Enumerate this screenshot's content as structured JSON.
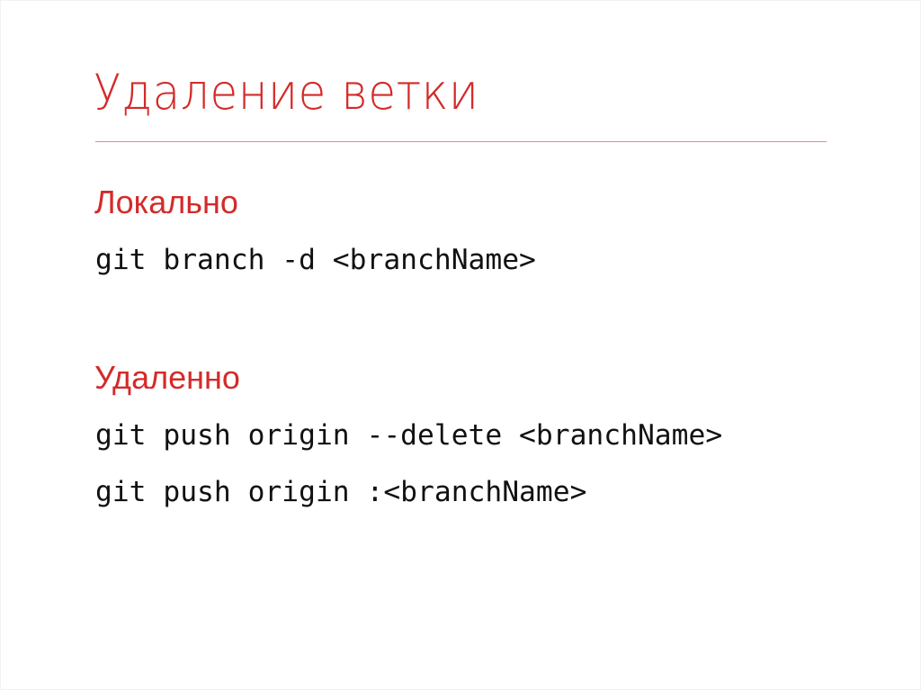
{
  "slide": {
    "title": "Удаление ветки",
    "accent_color": "#d42a2a",
    "sections": [
      {
        "heading": "Локально",
        "commands": [
          "git branch -d <branchName>"
        ]
      },
      {
        "heading": "Удаленно",
        "commands": [
          "git push origin --delete <branchName>",
          "git push origin :<branchName>"
        ]
      }
    ]
  }
}
